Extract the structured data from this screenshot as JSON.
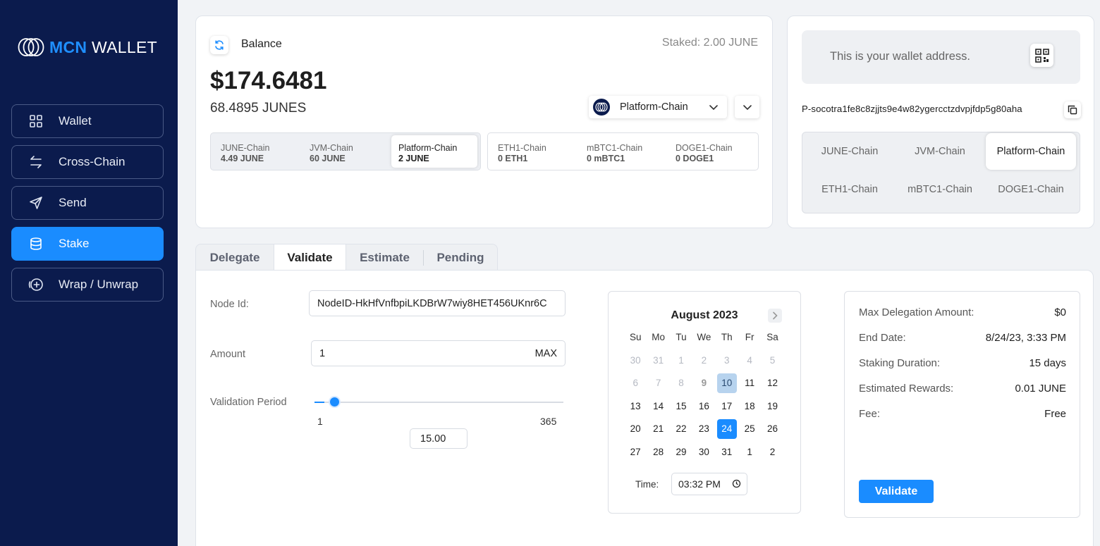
{
  "app": {
    "brand_mcn": "MCN",
    "brand_wallet": "WALLET"
  },
  "sidebar": {
    "items": [
      {
        "label": "Wallet",
        "icon": "grid-icon"
      },
      {
        "label": "Cross-Chain",
        "icon": "swap-arrows-icon"
      },
      {
        "label": "Send",
        "icon": "paper-plane-icon"
      },
      {
        "label": "Stake",
        "icon": "database-stack-icon",
        "active": true
      },
      {
        "label": "Wrap / Unwrap",
        "icon": "plus-circle-arrow-icon"
      }
    ]
  },
  "balance": {
    "label": "Balance",
    "staked": "Staked: 2.00 JUNE",
    "usd": "$174.6481",
    "junes": "68.4895 JUNES",
    "selected_chain": "Platform-Chain",
    "native_chains": [
      {
        "name": "JUNE-Chain",
        "value": "4.49 JUNE"
      },
      {
        "name": "JVM-Chain",
        "value": "60 JUNE"
      },
      {
        "name": "Platform-Chain",
        "value": "2 JUNE",
        "selected": true
      }
    ],
    "wrapped_chains": [
      {
        "name": "ETH1-Chain",
        "value": "0 ETH1"
      },
      {
        "name": "mBTC1-Chain",
        "value": "0 mBTC1"
      },
      {
        "name": "DOGE1-Chain",
        "value": "0 DOGE1"
      }
    ]
  },
  "address": {
    "hint": "This is your wallet address.",
    "value": "P-socotra1fe8c8zjjts9e4w82ygercctzdvpjfdp5g80aha",
    "chain_tabs": [
      {
        "label": "JUNE-Chain"
      },
      {
        "label": "JVM-Chain"
      },
      {
        "label": "Platform-Chain",
        "active": true
      },
      {
        "label": "ETH1-Chain"
      },
      {
        "label": "mBTC1-Chain"
      },
      {
        "label": "DOGE1-Chain"
      }
    ]
  },
  "tabs": [
    {
      "label": "Delegate"
    },
    {
      "label": "Validate",
      "active": true
    },
    {
      "label": "Estimate"
    },
    {
      "label": "Pending"
    }
  ],
  "form": {
    "node_id_label": "Node Id:",
    "node_id_value": "NodeID-HkHfVnfbpiLKDBrW7wiy8HET456UKnr6C",
    "amount_label": "Amount",
    "amount_value": "1",
    "max_label": "MAX",
    "period_label": "Validation Period",
    "slider_min": "1",
    "slider_max": "365",
    "slider_value": 15,
    "period_value": "15.00"
  },
  "calendar": {
    "title": "August 2023",
    "weekdays": [
      "Su",
      "Mo",
      "Tu",
      "We",
      "Th",
      "Fr",
      "Sa"
    ],
    "weeks": [
      [
        {
          "d": "30",
          "s": "muted"
        },
        {
          "d": "31",
          "s": "muted"
        },
        {
          "d": "1",
          "s": "muted"
        },
        {
          "d": "2",
          "s": "muted"
        },
        {
          "d": "3",
          "s": "muted"
        },
        {
          "d": "4",
          "s": "muted"
        },
        {
          "d": "5",
          "s": "muted"
        }
      ],
      [
        {
          "d": "6",
          "s": "muted"
        },
        {
          "d": "7",
          "s": "muted"
        },
        {
          "d": "8",
          "s": "muted"
        },
        {
          "d": "9",
          "s": "bold"
        },
        {
          "d": "10",
          "s": "today"
        },
        {
          "d": "11",
          "s": ""
        },
        {
          "d": "12",
          "s": ""
        }
      ],
      [
        {
          "d": "13",
          "s": ""
        },
        {
          "d": "14",
          "s": ""
        },
        {
          "d": "15",
          "s": ""
        },
        {
          "d": "16",
          "s": ""
        },
        {
          "d": "17",
          "s": ""
        },
        {
          "d": "18",
          "s": ""
        },
        {
          "d": "19",
          "s": ""
        }
      ],
      [
        {
          "d": "20",
          "s": ""
        },
        {
          "d": "21",
          "s": ""
        },
        {
          "d": "22",
          "s": ""
        },
        {
          "d": "23",
          "s": ""
        },
        {
          "d": "24",
          "s": "selected"
        },
        {
          "d": "25",
          "s": ""
        },
        {
          "d": "26",
          "s": ""
        }
      ],
      [
        {
          "d": "27",
          "s": ""
        },
        {
          "d": "28",
          "s": ""
        },
        {
          "d": "29",
          "s": ""
        },
        {
          "d": "30",
          "s": ""
        },
        {
          "d": "31",
          "s": ""
        },
        {
          "d": "1",
          "s": ""
        },
        {
          "d": "2",
          "s": ""
        }
      ]
    ],
    "time_label": "Time:",
    "time_value": "03:32 PM"
  },
  "summary": {
    "rows": [
      {
        "key": "Max Delegation Amount:",
        "value": "$0"
      },
      {
        "key": "End Date:",
        "value": "8/24/23, 3:33 PM"
      },
      {
        "key": "Staking Duration:",
        "value": "15 days"
      },
      {
        "key": "Estimated Rewards:",
        "value": "0.01 JUNE"
      },
      {
        "key": "Fee:",
        "value": "Free"
      }
    ],
    "button": "Validate"
  },
  "colors": {
    "sidebar_bg": "#0b1b4d",
    "accent": "#1a8cff",
    "today_highlight": "#b7d3ee"
  }
}
